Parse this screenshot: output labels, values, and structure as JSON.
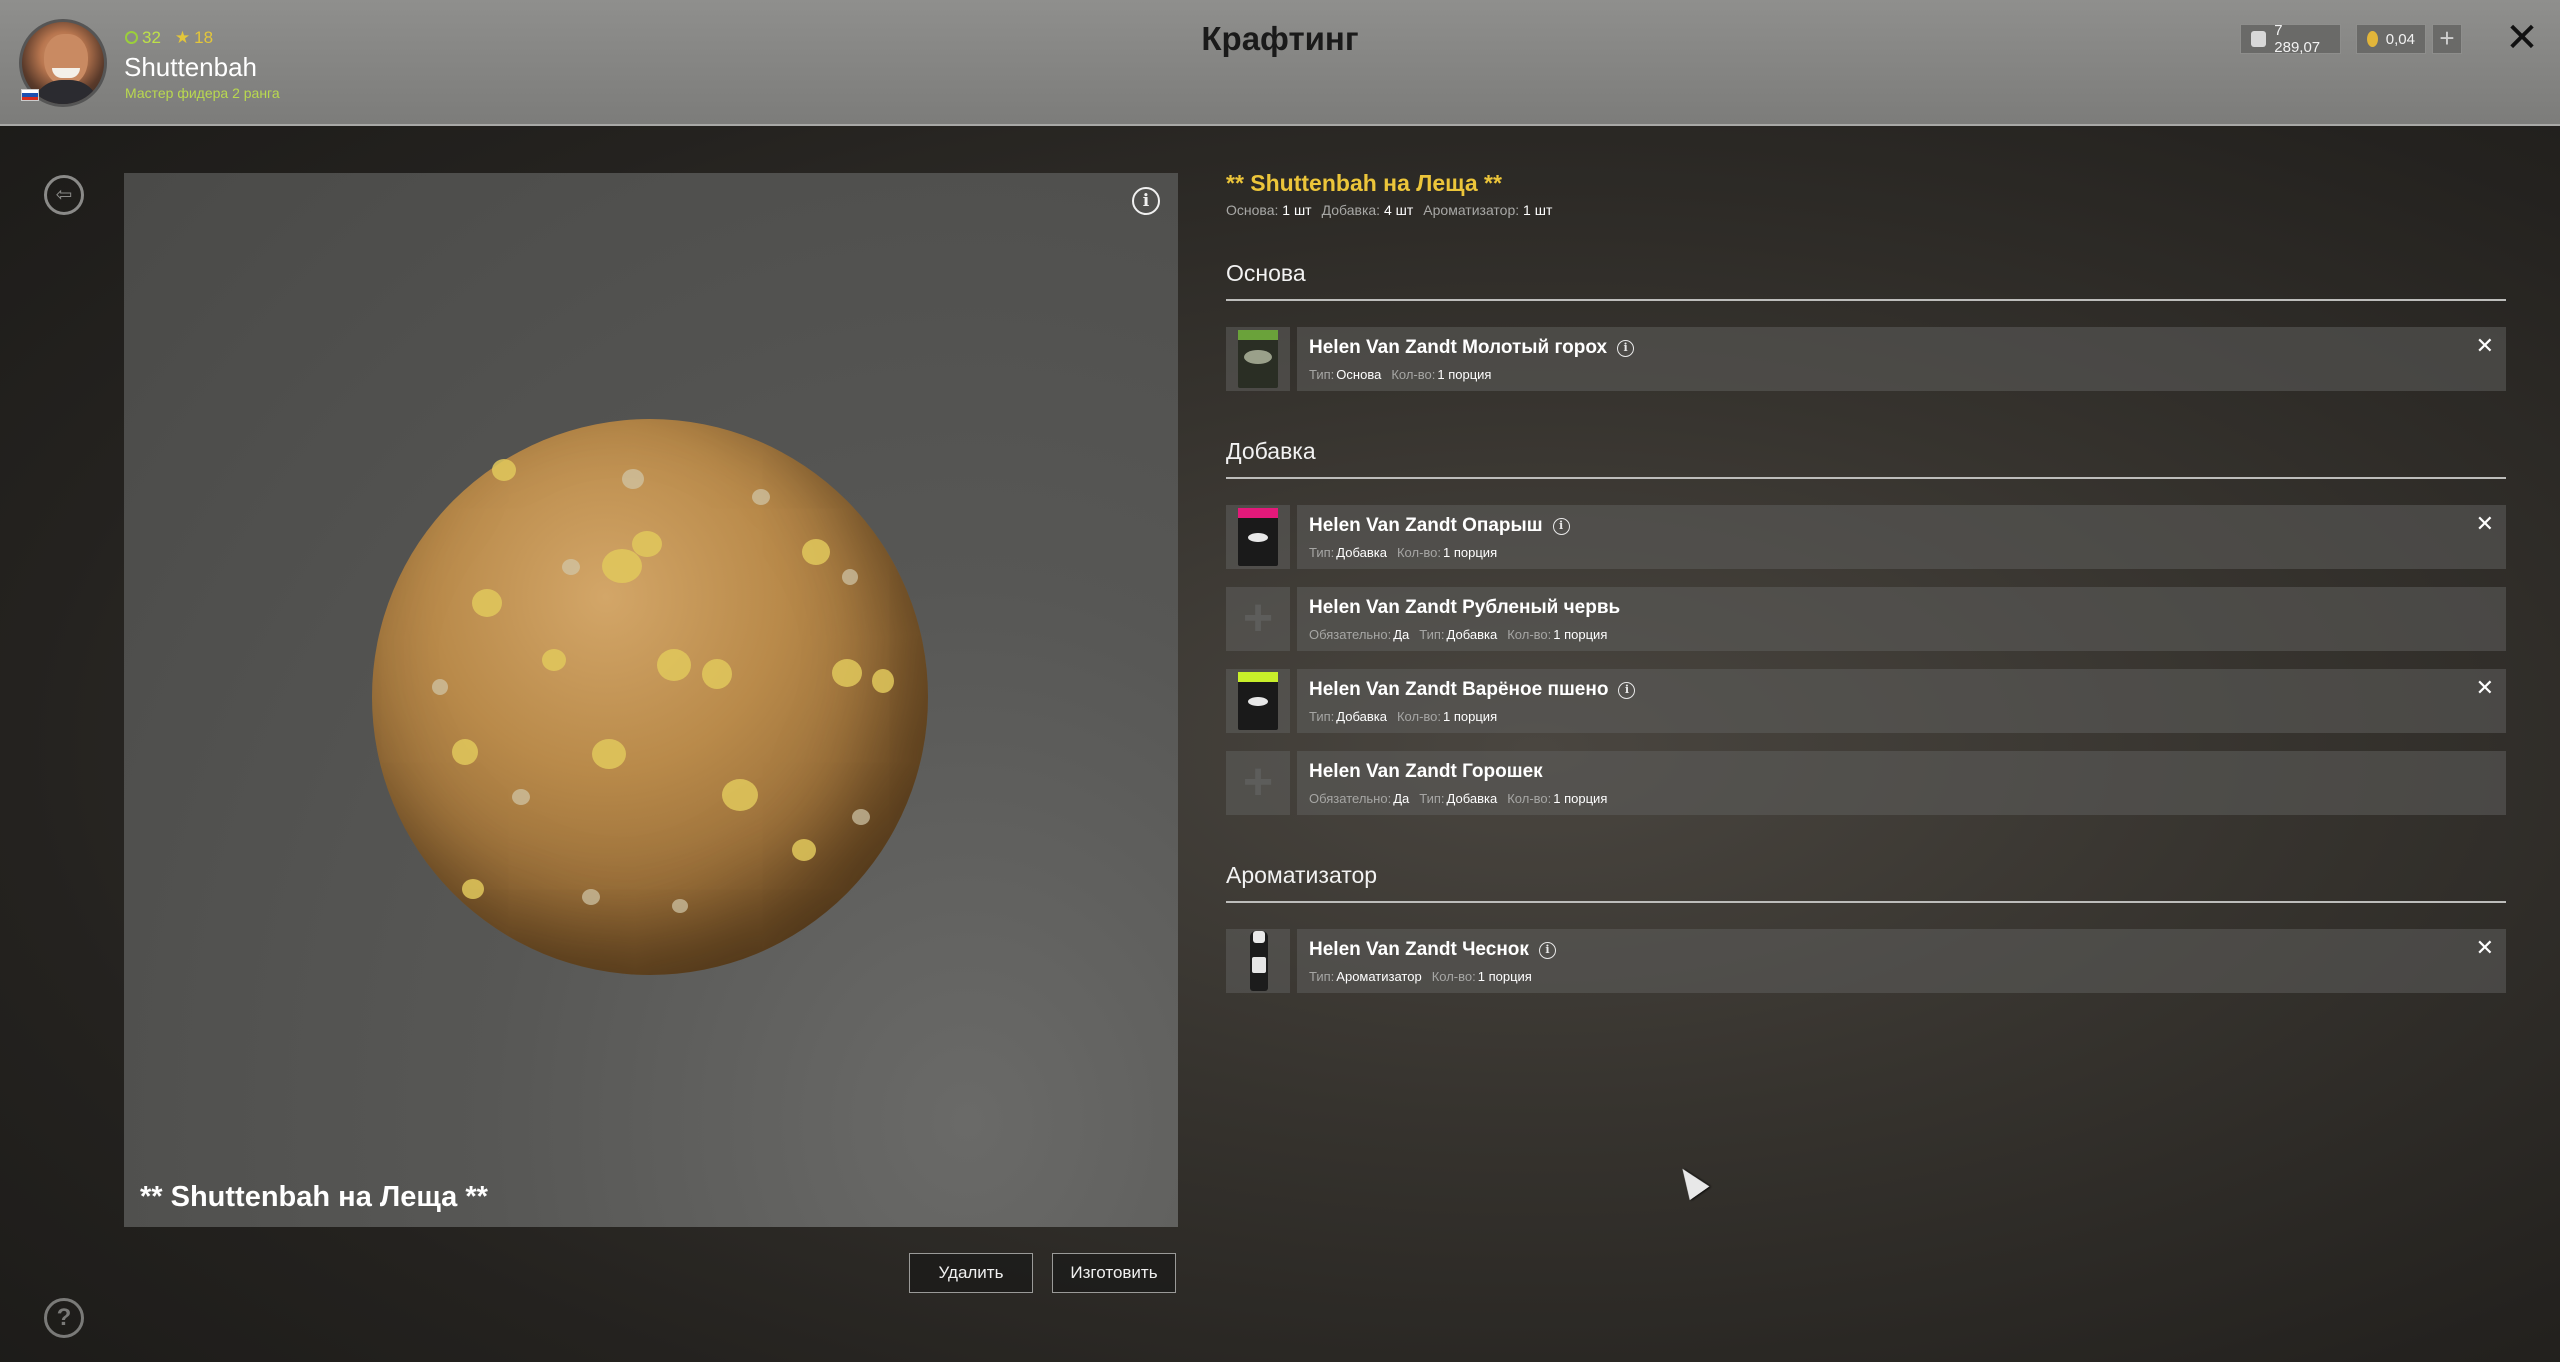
{
  "header": {
    "title": "Крафтинг",
    "player": {
      "name": "Shuttenbah",
      "rank": "Мастер фидера 2 ранга",
      "level": "32",
      "stars": "18"
    },
    "currency": {
      "silver": "7 289,07",
      "gold": "0,04"
    },
    "add_label": "+",
    "close_label": "✕"
  },
  "preview": {
    "name": "** Shuttenbah на Леща **",
    "info_label": "i",
    "delete_label": "Удалить",
    "make_label": "Изготовить"
  },
  "recipe": {
    "title": "** Shuttenbah на Леща **",
    "summary": [
      {
        "label": "Основа:",
        "value": "1 шт"
      },
      {
        "label": "Добавка:",
        "value": "4 шт"
      },
      {
        "label": "Ароматизатор:",
        "value": "1 шт"
      }
    ],
    "sections": {
      "base": "Основа",
      "additive": "Добавка",
      "flavor": "Ароматизатор"
    },
    "meta_labels": {
      "type": "Тип:",
      "qty": "Кол-во:",
      "required": "Обязательно:"
    },
    "items": [
      {
        "name": "Helen Van Zandt Молотый горох",
        "type": "Основа",
        "qty": "1 порция"
      },
      {
        "name": "Helen Van Zandt Опарыш",
        "type": "Добавка",
        "qty": "1 порция"
      },
      {
        "name": "Helen Van Zandt Рубленый червь",
        "required": "Да",
        "type": "Добавка",
        "qty": "1 порция"
      },
      {
        "name": "Helen Van Zandt Варёное пшено",
        "type": "Добавка",
        "qty": "1 порция"
      },
      {
        "name": "Helen Van Zandt Горошек",
        "required": "Да",
        "type": "Добавка",
        "qty": "1 порция"
      },
      {
        "name": "Helen Van Zandt Чеснок",
        "type": "Ароматизатор",
        "qty": "1 порция"
      }
    ]
  },
  "icons": {
    "back": "exit-icon",
    "help": "question-icon",
    "remove": "close-icon",
    "add_slot": "plus-icon"
  },
  "colors": {
    "accent": "#ecc53a",
    "rank": "#b9d94f"
  }
}
